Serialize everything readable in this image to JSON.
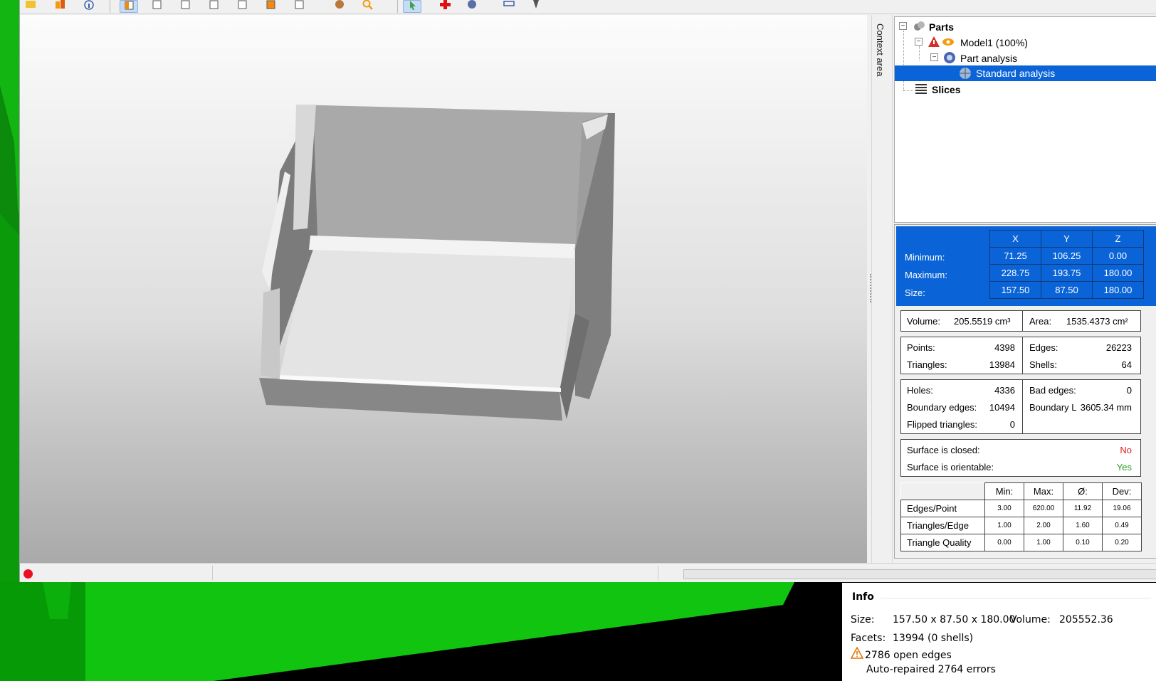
{
  "tree": {
    "parts_label": "Parts",
    "model_label": "Model1 (100%)",
    "analysis_label": "Part analysis",
    "standard_label": "Standard analysis",
    "slices_label": "Slices"
  },
  "context_area_label": "Context area",
  "bbox": {
    "headers": [
      "X",
      "Y",
      "Z"
    ],
    "rows": [
      {
        "label": "Minimum:",
        "x": "71.25",
        "y": "106.25",
        "z": "0.00"
      },
      {
        "label": "Maximum:",
        "x": "228.75",
        "y": "193.75",
        "z": "180.00"
      },
      {
        "label": "Size:",
        "x": "157.50",
        "y": "87.50",
        "z": "180.00"
      }
    ]
  },
  "volume_area": {
    "volume_label": "Volume:",
    "volume_value": "205.5519 cm³",
    "area_label": "Area:",
    "area_value": "1535.4373 cm²"
  },
  "mesh": {
    "points_label": "Points:",
    "points_value": "4398",
    "triangles_label": "Triangles:",
    "triangles_value": "13984",
    "edges_label": "Edges:",
    "edges_value": "26223",
    "shells_label": "Shells:",
    "shells_value": "64"
  },
  "errors": {
    "holes_label": "Holes:",
    "holes_value": "4336",
    "boundary_edges_label": "Boundary edges:",
    "boundary_edges_value": "10494",
    "flipped_label": "Flipped triangles:",
    "flipped_value": "0",
    "bad_edges_label": "Bad edges:",
    "bad_edges_value": "0",
    "boundary_length_label": "Boundary L",
    "boundary_length_value": "3605.34 mm"
  },
  "surface": {
    "closed_label": "Surface is closed:",
    "closed_value": "No",
    "closed_color": "#e02020",
    "orientable_label": "Surface is orientable:",
    "orientable_value": "Yes",
    "orientable_color": "#2a9a2a"
  },
  "quality": {
    "headers": [
      "Min:",
      "Max:",
      "Ø:",
      "Dev:"
    ],
    "rows": [
      {
        "label": "Edges/Point",
        "min": "3.00",
        "max": "620.00",
        "avg": "11.92",
        "dev": "19.06"
      },
      {
        "label": "Triangles/Edge",
        "min": "1.00",
        "max": "2.00",
        "avg": "1.60",
        "dev": "0.49"
      },
      {
        "label": "Triangle Quality",
        "min": "0.00",
        "max": "1.00",
        "avg": "0.10",
        "dev": "0.20"
      }
    ]
  },
  "info": {
    "title": "Info",
    "size_label": "Size:",
    "size_value": "157.50 x 87.50 x 180.00",
    "volume_label": "Volume:",
    "volume_value": "205552.36",
    "facets_label": "Facets:",
    "facets_value": "13994 (0 shells)",
    "open_edges": "2786 open edges",
    "auto_repaired": "Auto-repaired 2764 errors"
  },
  "colors": {
    "selection_blue": "#0a64d8",
    "desktop_green": "#0fbf0f",
    "record_red": "#e81123"
  },
  "icons": [
    "open-folder-icon",
    "parts-icon",
    "info-icon",
    "view-front-icon",
    "view-back-icon",
    "view-left-icon",
    "view-right-icon",
    "view-top-icon",
    "view-bottom-icon",
    "view-iso-icon",
    "sphere-icon",
    "zoom-icon",
    "select-arrow-icon",
    "add-icon",
    "rotate-icon",
    "rectangle-icon",
    "pin-icon"
  ]
}
